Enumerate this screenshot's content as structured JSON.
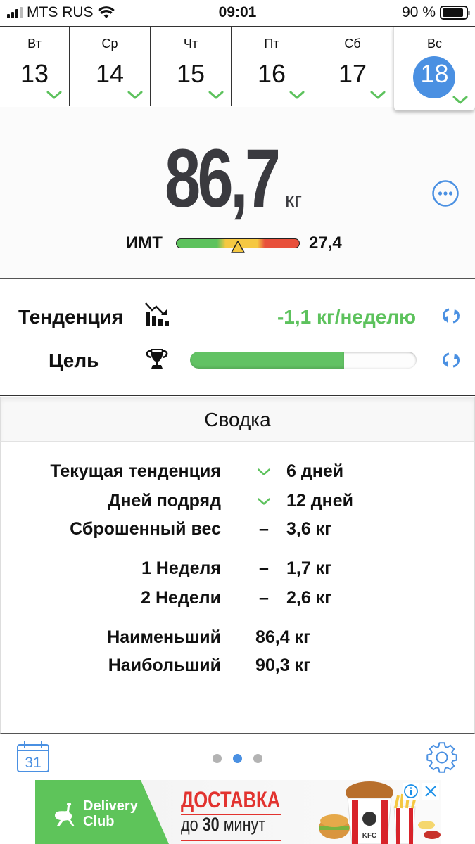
{
  "status_bar": {
    "carrier": "MTS RUS",
    "time": "09:01",
    "battery_text": "90 %",
    "battery_level": 0.9,
    "signal_bars": 3
  },
  "days": [
    {
      "name": "Вт",
      "number": "13",
      "checked": true,
      "selected": false
    },
    {
      "name": "Ср",
      "number": "14",
      "checked": true,
      "selected": false
    },
    {
      "name": "Чт",
      "number": "15",
      "checked": true,
      "selected": false
    },
    {
      "name": "Пт",
      "number": "16",
      "checked": true,
      "selected": false
    },
    {
      "name": "Сб",
      "number": "17",
      "checked": true,
      "selected": false
    },
    {
      "name": "Вс",
      "number": "18",
      "checked": true,
      "selected": true
    }
  ],
  "weight": {
    "value": "86,7",
    "unit": "кг",
    "more_icon": "ellipsis-circle-icon"
  },
  "bmi": {
    "label": "ИМТ",
    "value": "27,4",
    "marker_position": 0.5
  },
  "trend": {
    "label": "Тенденция",
    "icon": "trend-down-chart-icon",
    "value": "-1,1 кг/неделю",
    "refresh_icon": "refresh-icon"
  },
  "goal": {
    "label": "Цель",
    "icon": "trophy-icon",
    "progress": 0.68,
    "refresh_icon": "refresh-icon"
  },
  "summary": {
    "title": "Сводка",
    "rows": [
      {
        "label": "Текущая тенденция",
        "marker": "check",
        "value": "6 дней"
      },
      {
        "label": "Дней подряд",
        "marker": "check",
        "value": "12 дней"
      },
      {
        "label": "Сброшенный вес",
        "marker": "–",
        "value": "3,6 кг"
      },
      {
        "label": "1 Неделя",
        "marker": "–",
        "value": "1,7 кг"
      },
      {
        "label": "2 Недели",
        "marker": "–",
        "value": "2,6 кг"
      },
      {
        "label": "Наименьший",
        "marker": "",
        "value": "86,4 кг"
      },
      {
        "label": "Наибольший",
        "marker": "",
        "value": "90,3 кг"
      }
    ]
  },
  "toolbar": {
    "calendar_day": "31",
    "page_count": 3,
    "active_page": 1
  },
  "ad": {
    "brand_line1": "Delivery",
    "brand_line2": "Club",
    "headline": "ДОСТАВКА",
    "sub_prefix": "до",
    "sub_number": "30",
    "sub_suffix": "минут",
    "food_brand": "KFC"
  },
  "colors": {
    "accent_blue": "#4a90e2",
    "green": "#5dc25d",
    "yellow": "#f5c842",
    "red": "#e8503b",
    "ad_green": "#5ec45a",
    "ad_red": "#e2332f"
  }
}
